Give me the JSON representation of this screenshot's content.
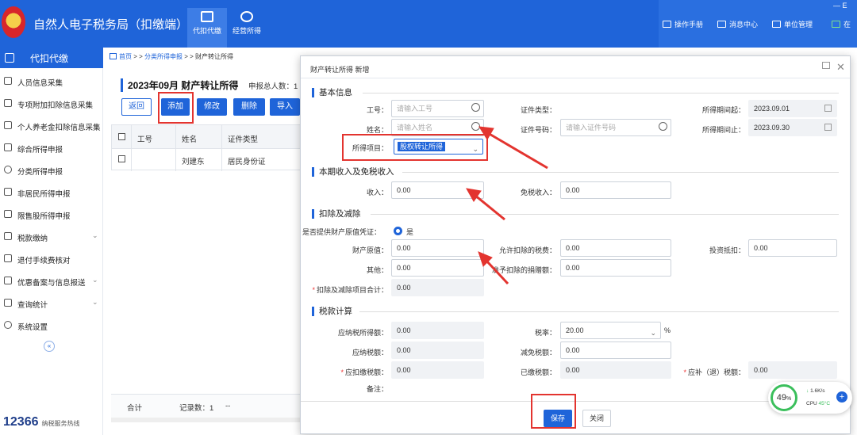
{
  "app": {
    "title": "自然人电子税务局（扣缴端）",
    "min_btn": "— E"
  },
  "topnav": [
    {
      "label": "代扣代缴",
      "icon": "wallet-icon"
    },
    {
      "label": "经营所得",
      "icon": "coins-icon"
    }
  ],
  "toolbar_right": [
    {
      "label": "操作手册",
      "icon": "manual-icon"
    },
    {
      "label": "消息中心",
      "icon": "mail-icon"
    },
    {
      "label": "单位管理",
      "icon": "building-icon"
    },
    {
      "label": "在",
      "icon": "monitor-icon"
    }
  ],
  "sidebar": {
    "header": "代扣代缴",
    "items": [
      {
        "label": "人员信息采集",
        "chev": ""
      },
      {
        "label": "专项附加扣除信息采集",
        "chev": ""
      },
      {
        "label": "个人养老金扣除信息采集",
        "chev": ""
      },
      {
        "label": "综合所得申报",
        "chev": ""
      },
      {
        "label": "分类所得申报",
        "chev": ""
      },
      {
        "label": "非居民所得申报",
        "chev": ""
      },
      {
        "label": "限售股所得申报",
        "chev": ""
      },
      {
        "label": "税款缴纳",
        "chev": "⌄"
      },
      {
        "label": "退付手续费核对",
        "chev": ""
      },
      {
        "label": "优惠备案与信息报送",
        "chev": "⌄"
      },
      {
        "label": "查询统计",
        "chev": "⌄"
      },
      {
        "label": "系统设置",
        "chev": ""
      }
    ],
    "collapse": "«",
    "hotline_label": "纳税服务热线",
    "hotline_num": "12366"
  },
  "breadcrumb": {
    "home": "首页",
    "sep1": " > > ",
    "mid": "分类所得申报",
    "sep2": " > > ",
    "current": "财产转让所得"
  },
  "page": {
    "heading": "2023年09月  财产转让所得",
    "decl_count": "申报总人数：1",
    "buttons": [
      "返回",
      "添加",
      "修改",
      "删除",
      "导入"
    ],
    "columns": [
      "工号",
      "姓名",
      "证件类型"
    ],
    "rows": [
      [
        "",
        "刘建东",
        "居民身份证"
      ]
    ],
    "footer_total": "合计",
    "footer_records": "记录数：1",
    "footer_dash": "--"
  },
  "modal": {
    "title": "财产转让所得 新增",
    "sec_basic": "基本信息",
    "sec_income": "本期收入及免税收入",
    "sec_deduct": "扣除及减除",
    "sec_tax": "税款计算",
    "emp_no_label": "工号：",
    "emp_no_ph": "请输入工号",
    "name_label": "姓名：",
    "name_ph": "请输入姓名",
    "id_type_label": "证件类型：",
    "id_no_label": "证件号码：",
    "id_no_ph": "请输入证件号码",
    "period_start_label": "所得期间起：",
    "period_start": "2023.09.01",
    "period_end_label": "所得期间止：",
    "period_end": "2023.09.30",
    "item_label": "所得项目：",
    "item_value": "股权转让所得",
    "income_label": "收入：",
    "income": "0.00",
    "taxfree_label": "免税收入：",
    "taxfree": "0.00",
    "proof_label": "是否提供财产原值凭证：",
    "proof_value": "是",
    "orig_label": "财产原值：",
    "orig": "0.00",
    "allowed_tax_label": "允许扣除的税费：",
    "allowed_tax": "0.00",
    "invest_label": "投资抵扣：",
    "invest": "0.00",
    "other_label": "其他：",
    "other": "0.00",
    "donation_label": "准予扣除的捐赠额：",
    "donation": "0.00",
    "deduct_total_label": "扣除及减除项目合计：",
    "deduct_total": "0.00",
    "taxable_label": "应纳税所得额：",
    "taxable": "0.00",
    "rate_label": "税率：",
    "rate": "20.00",
    "rate_unit": "%",
    "payable_label": "应纳税额：",
    "payable": "0.00",
    "relief_label": "减免税额：",
    "relief": "0.00",
    "withhold_label": "应扣缴税额：",
    "withhold": "0.00",
    "paid_label": "已缴税额：",
    "paid": "0.00",
    "refund_label": "应补（退）税额：",
    "refund": "0.00",
    "remark_label": "备注：",
    "save": "保存",
    "close": "关闭"
  },
  "cpu": {
    "percent": "49",
    "pct_sign": "%",
    "net": "1.6K/s",
    "cpu_label": "CPU",
    "temp": "45°C"
  },
  "colors": {
    "brand": "#1f64d9",
    "highlight": "#e3342f",
    "ok": "#3bbf5c"
  }
}
